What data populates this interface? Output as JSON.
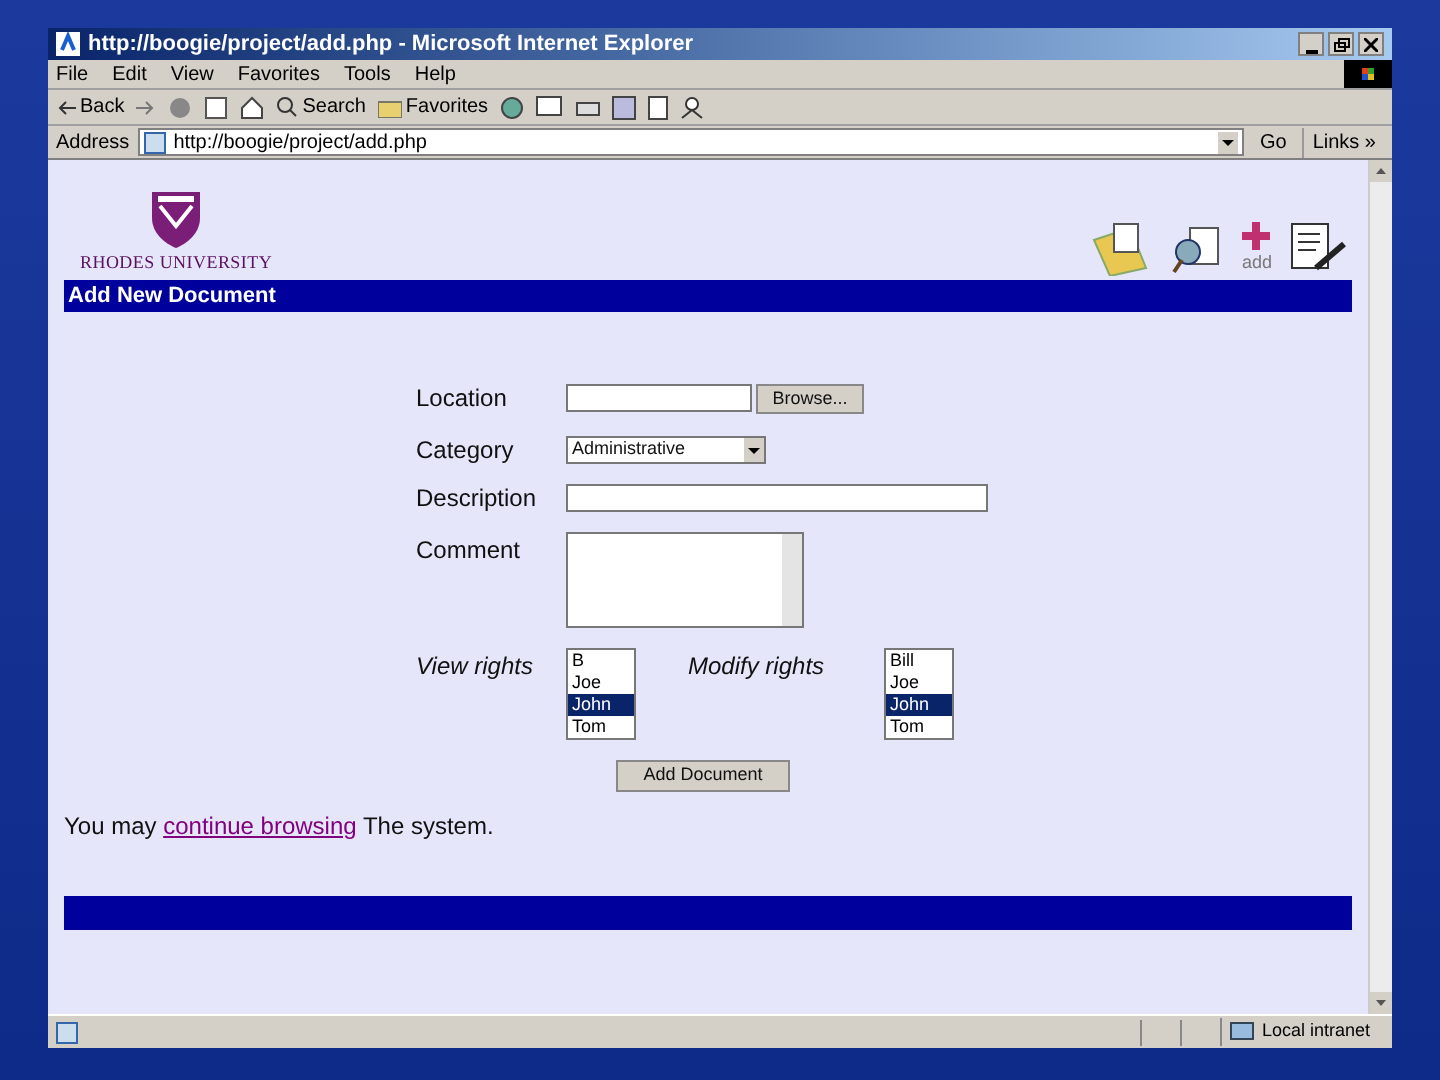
{
  "window": {
    "title": "http://boogie/project/add.php - Microsoft Internet Explorer"
  },
  "menu": [
    "File",
    "Edit",
    "View",
    "Favorites",
    "Tools",
    "Help"
  ],
  "toolbar": {
    "back": "Back",
    "search": "Search",
    "favorites": "Favorites"
  },
  "address_bar": {
    "label": "Address",
    "value": "http://boogie/project/add.php",
    "go": "Go",
    "links": "Links »"
  },
  "page": {
    "logo_text": "RHODES UNIVERSITY",
    "add_label": "add",
    "heading": "Add New Document",
    "form": {
      "location_label": "Location",
      "browse_button": "Browse...",
      "category_label": "Category",
      "category_value": "Administrative",
      "description_label": "Description",
      "comment_label": "Comment",
      "view_rights_label": "View rights",
      "view_rights": [
        {
          "name": "B",
          "selected": false
        },
        {
          "name": "Joe",
          "selected": false
        },
        {
          "name": "John",
          "selected": true
        },
        {
          "name": "Tom",
          "selected": false
        }
      ],
      "modify_rights_label": "Modify rights",
      "modify_rights": [
        {
          "name": "Bill",
          "selected": false
        },
        {
          "name": "Joe",
          "selected": false
        },
        {
          "name": "John",
          "selected": true
        },
        {
          "name": "Tom",
          "selected": false
        }
      ],
      "submit_button": "Add Document"
    },
    "footer_text": {
      "before": "You may",
      "link": "continue browsing",
      "after": "The system."
    }
  },
  "status_bar": {
    "zone": "Local intranet"
  }
}
